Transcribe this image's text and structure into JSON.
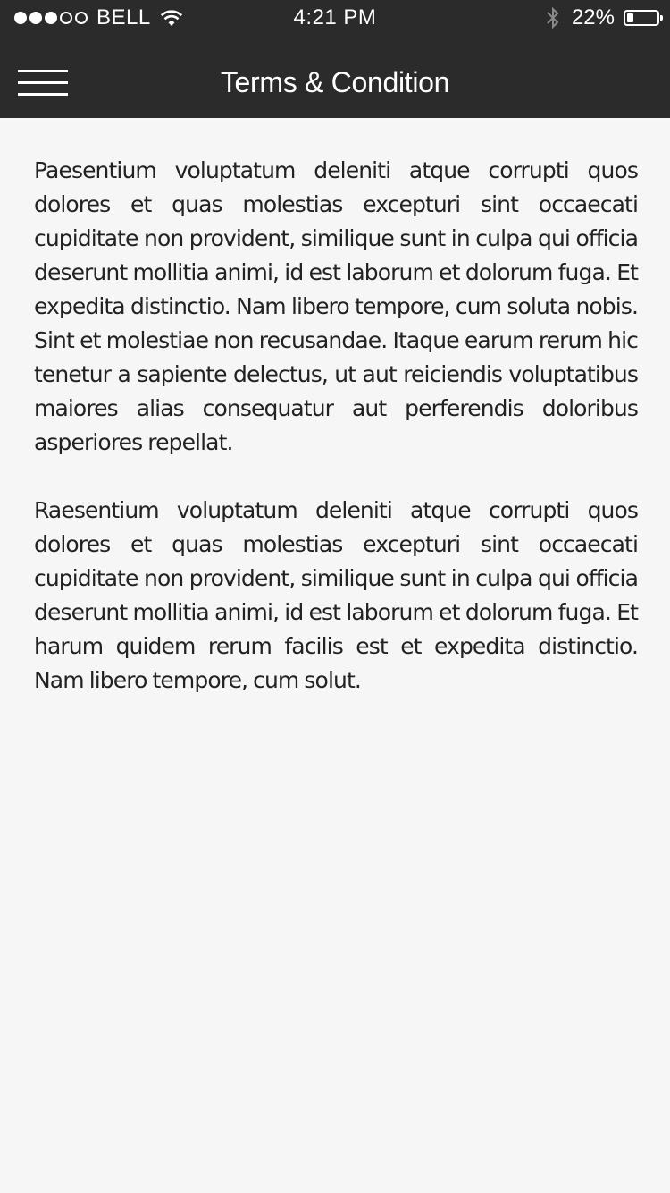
{
  "status_bar": {
    "carrier": "BELL",
    "time": "4:21 PM",
    "battery_percent": "22%",
    "battery_level": 0.22,
    "signal_bars_filled": 3,
    "signal_bars_total": 5,
    "icons": {
      "wifi": "wifi-icon",
      "bluetooth": "bluetooth-icon",
      "battery": "battery-icon"
    }
  },
  "nav": {
    "title": "Terms & Condition",
    "menu_icon": "hamburger-menu-icon"
  },
  "terms": {
    "paragraphs": [
      "Paesentium voluptatum deleniti atque corrupti quos dolores et quas molestias excepturi sint occaecati cupiditate non provident, similique sunt in culpa qui officia deserunt mollitia animi, id est laborum et dolorum fuga. Et expedita distinctio. Nam libero tempore, cum soluta nobis. Sint et molestiae non recusandae. Itaque earum rerum hic tenetur a sapiente delectus, ut aut reiciendis voluptatibus maiores alias consequatur aut perferendis doloribus asperiores repellat.",
      "Raesentium voluptatum deleniti atque corrupti quos dolores et quas molestias excepturi sint occaecati cupiditate non provident, similique sunt in culpa qui officia deserunt mollitia animi, id est laborum et dolorum fuga. Et harum quidem rerum facilis est et expedita distinctio. Nam libero tempore, cum solut."
    ]
  },
  "colors": {
    "header_bg": "#2b2b2b",
    "page_bg": "#f6f6f6",
    "body_text": "#222222"
  }
}
